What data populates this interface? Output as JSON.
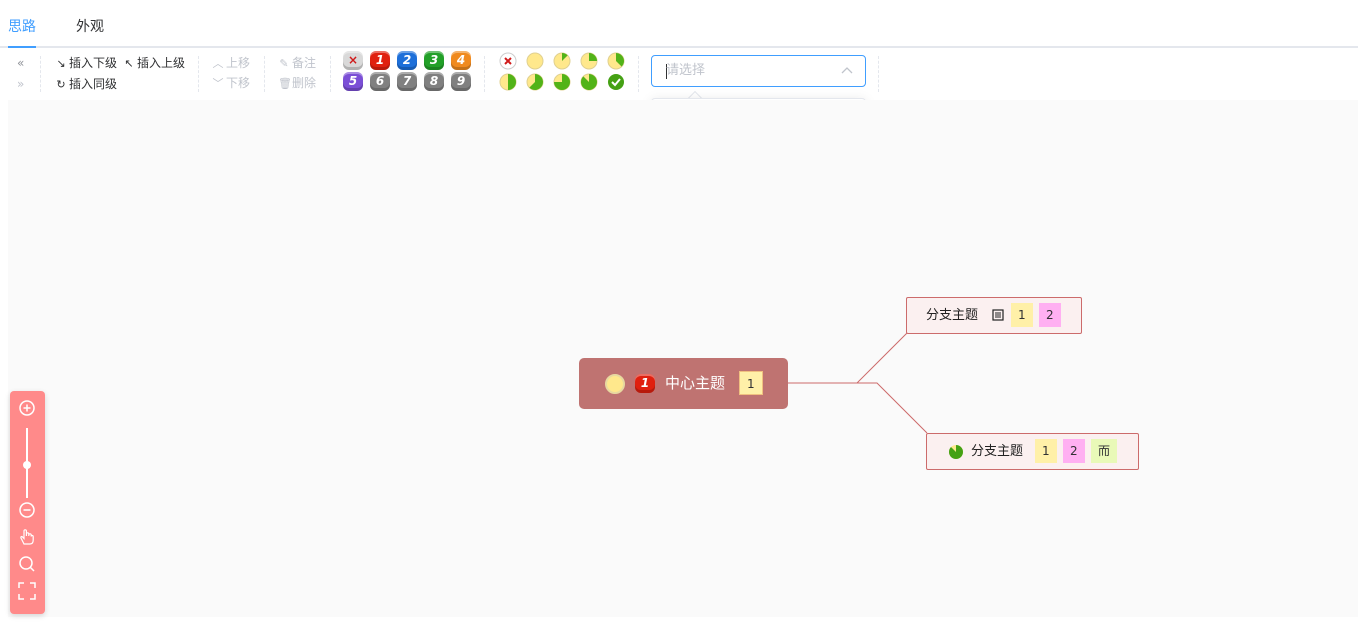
{
  "tabs": [
    {
      "label": "思路",
      "active": true
    },
    {
      "label": "外观",
      "active": false
    }
  ],
  "toolbar": {
    "insert_child": "插入下级",
    "insert_parent": "插入上级",
    "insert_sibling": "插入同级",
    "move_up": "上移",
    "move_down": "下移",
    "note": "备注",
    "delete": "删除",
    "priority": [
      {
        "label": "×",
        "color": "#d9d9d9"
      },
      {
        "label": "1",
        "color": "#e0200f"
      },
      {
        "label": "2",
        "color": "#1d6fd9"
      },
      {
        "label": "3",
        "color": "#22a028"
      },
      {
        "label": "4",
        "color": "#f08a1e"
      },
      {
        "label": "5",
        "color": "#7b4fd6"
      },
      {
        "label": "6",
        "color": "#808080"
      },
      {
        "label": "7",
        "color": "#808080"
      },
      {
        "label": "8",
        "color": "#808080"
      },
      {
        "label": "9",
        "color": "#808080"
      }
    ],
    "progress_icons": [
      "progress-clear-icon",
      "progress-0-icon",
      "progress-1-icon",
      "progress-2-icon",
      "progress-3-icon",
      "progress-4-icon",
      "progress-5-icon",
      "progress-6-icon",
      "progress-7-icon",
      "progress-done-icon"
    ],
    "progress_colors": {
      "fill": "#ffe88c",
      "done": "#45a114",
      "accent": "#52b318"
    }
  },
  "tag_select": {
    "placeholder": "请选择",
    "options": [
      {
        "label": "1",
        "color": "#fff0a8"
      },
      {
        "label": "2",
        "color": "#ffb0f2"
      },
      {
        "label": "而",
        "color": "#e9f9b8"
      }
    ]
  },
  "mindmap": {
    "root": {
      "text": "中心主题",
      "priority": "1",
      "tags": [
        "1"
      ],
      "color": "#bf7371"
    },
    "children": [
      {
        "text": "分支主题",
        "has_note": true,
        "tags": [
          "1",
          "2"
        ]
      },
      {
        "text": "分支主题",
        "progress": "pie",
        "tags": [
          "1",
          "2",
          "而"
        ]
      }
    ],
    "line_color": "#cc6b6b"
  },
  "zoom_controls": [
    "zoom-in-icon",
    "zoom-slider",
    "zoom-out-icon",
    "hand-icon",
    "search-icon",
    "fullscreen-icon"
  ]
}
